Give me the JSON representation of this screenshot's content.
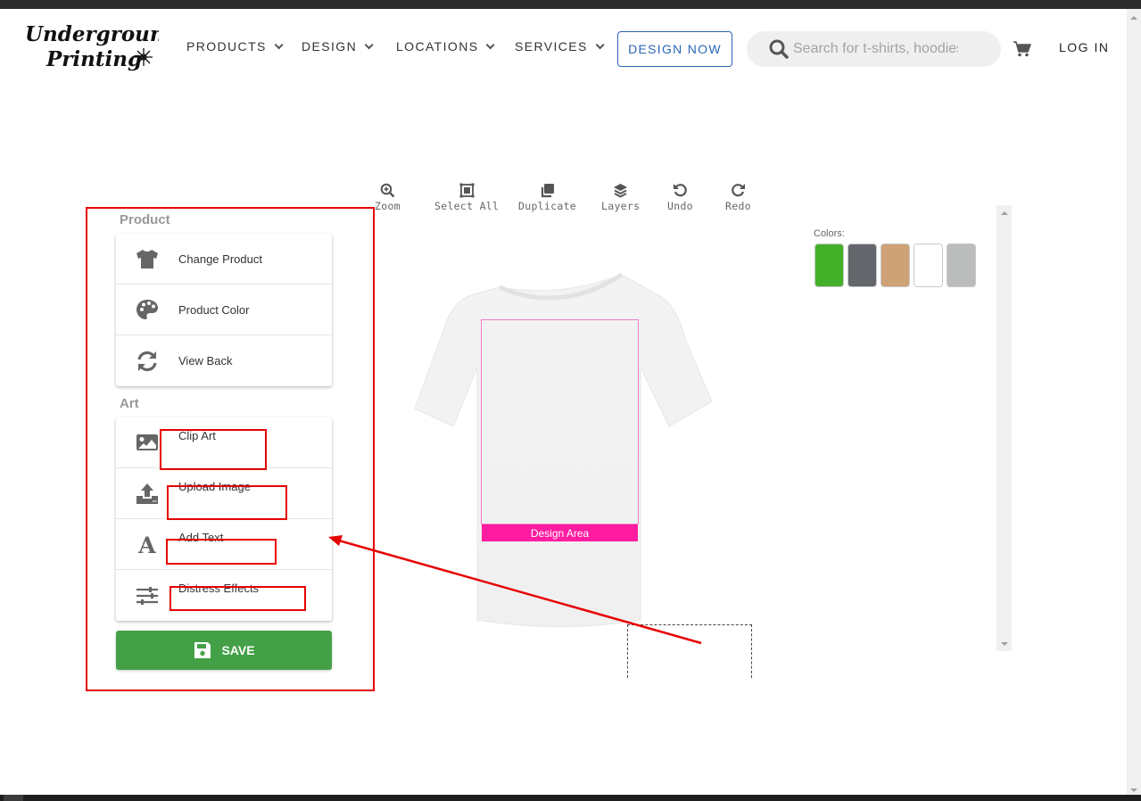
{
  "brand": {
    "name": "Underground Printing",
    "line1": "Underground",
    "line2": "Printing"
  },
  "nav": {
    "items": [
      {
        "label": "PRODUCTS"
      },
      {
        "label": "DESIGN"
      },
      {
        "label": "LOCATIONS"
      },
      {
        "label": "SERVICES"
      }
    ],
    "cta": "DESIGN NOW",
    "search_placeholder": "Search for t-shirts, hoodies",
    "login": "LOG IN"
  },
  "toolbar": {
    "tools": [
      {
        "label": "Zoom",
        "icon": "zoom-in-icon"
      },
      {
        "label": "Select All",
        "icon": "select-all-icon"
      },
      {
        "label": "Duplicate",
        "icon": "duplicate-icon"
      },
      {
        "label": "Layers",
        "icon": "layers-icon"
      },
      {
        "label": "Undo",
        "icon": "undo-icon"
      },
      {
        "label": "Redo",
        "icon": "redo-icon"
      }
    ]
  },
  "panel": {
    "product_section": {
      "title": "Product",
      "items": [
        {
          "label": "Change Product",
          "icon": "tshirt-icon"
        },
        {
          "label": "Product Color",
          "icon": "palette-icon"
        },
        {
          "label": "View Back",
          "icon": "sync-icon"
        }
      ]
    },
    "art_section": {
      "title": "Art",
      "items": [
        {
          "label": "Clip Art",
          "icon": "image-icon"
        },
        {
          "label": "Upload Image",
          "icon": "upload-icon"
        },
        {
          "label": "Add Text",
          "icon": "text-icon"
        },
        {
          "label": "Distress Effects",
          "icon": "sliders-icon"
        }
      ]
    },
    "save_label": "SAVE"
  },
  "canvas": {
    "design_area_label": "Design Area",
    "accent_color": "#ff1ca1"
  },
  "colors": {
    "label": "Colors:",
    "swatches": [
      "#43b02a",
      "#63666a",
      "#cfa177",
      "#ffffff",
      "#bbbcbc"
    ]
  },
  "annotation_color": "#e60000"
}
